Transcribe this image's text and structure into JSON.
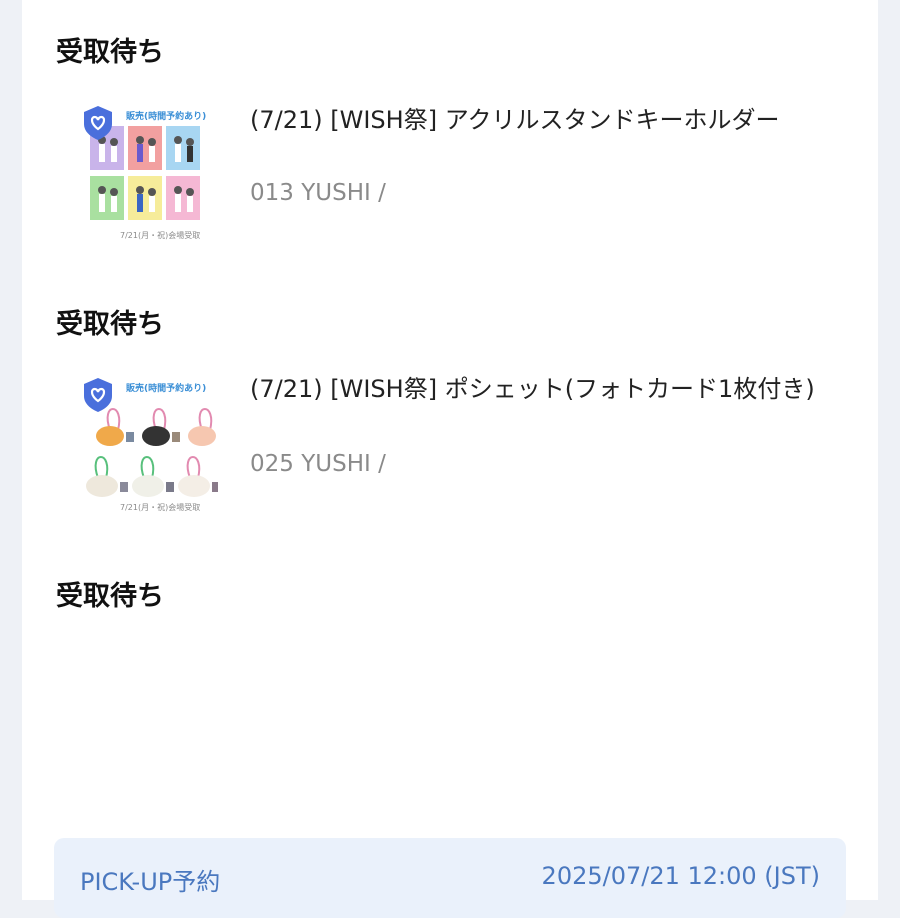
{
  "orders": [
    {
      "status": "受取待ち",
      "title": "(7/21) [WISH祭] アクリルスタンドキーホルダー",
      "subtitle": "013 YUSHI /",
      "thumbnail": {
        "banner": "販売(時間予約あり)",
        "footer": "7/21(月・祝)会場受取",
        "icon": "heart-shield-icon"
      }
    },
    {
      "status": "受取待ち",
      "title": "(7/21) [WISH祭] ポシェット(フォトカード1枚付き)",
      "subtitle": "025 YUSHI /",
      "thumbnail": {
        "banner": "販売(時間予約あり)",
        "footer": "7/21(月・祝)会場受取",
        "icon": "heart-shield-icon"
      }
    },
    {
      "status": "受取待ち"
    }
  ],
  "pickup": {
    "label": "PICK-UP予約",
    "datetime": "2025/07/21 12:00 (JST)"
  },
  "colors": {
    "page_bg": "#eef1f6",
    "card_bg": "#ffffff",
    "pickup_bg": "#eaf1fb",
    "pickup_text": "#4a78bf",
    "badge_blue": "#4a6fdc"
  }
}
